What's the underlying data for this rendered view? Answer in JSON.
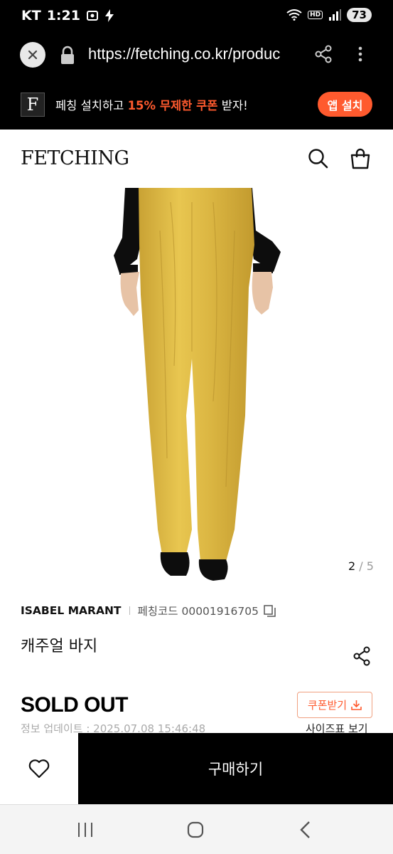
{
  "status_bar": {
    "carrier": "KT",
    "time": "1:21",
    "battery": "73",
    "network_badge": "HD"
  },
  "browser": {
    "url": "https://fetching.co.kr/produc"
  },
  "banner": {
    "logo_letter": "F",
    "text_before": "페칭 설치하고 ",
    "text_highlight": "15% 무제한 쿠폰",
    "text_after": " 받자!",
    "install_label": "앱 설치",
    "accent_color": "#ff5a2e"
  },
  "header": {
    "logo": "FETCHING"
  },
  "gallery": {
    "current": "2",
    "separator": " / ",
    "total": "5"
  },
  "product": {
    "brand": "ISABEL MARANT",
    "code_label": "페칭코드 00001916705",
    "name": "캐주얼 바지",
    "status": "SOLD OUT",
    "coupon_label": "쿠폰받기",
    "updated": "정보 업데이트 : 2025.07.08 15:46:48",
    "size_chart": "사이즈표 보기"
  },
  "action_bar": {
    "buy_label": "구매하기"
  },
  "icons": [
    "close-icon",
    "lock-icon",
    "share-icon",
    "more-icon",
    "search-icon",
    "bag-icon",
    "copy-icon",
    "download-icon",
    "heart-icon",
    "recents-icon",
    "home-icon",
    "back-icon"
  ]
}
